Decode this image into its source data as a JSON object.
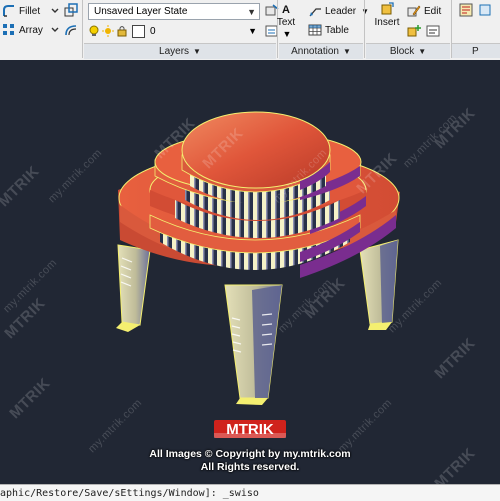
{
  "ribbon": {
    "modify": {
      "fillet": "Fillet",
      "array": "Array"
    },
    "layers": {
      "state": "Unsaved Layer State",
      "current_value": "0",
      "panel_label": "Layers"
    },
    "annotation": {
      "text": "Text",
      "leader": "Leader",
      "table": "Table",
      "panel_label": "Annotation"
    },
    "block": {
      "insert": "Insert",
      "edit": "Edit",
      "panel_label": "Block"
    },
    "extra_panel_label": "P"
  },
  "watermark": {
    "logo_text": "MTRIK",
    "line1": "All Images © Copyright by my.mtrik.com",
    "line2": "All Rights reserved.",
    "brand": "MTRIK",
    "site": "my.mtrik.com"
  },
  "command_line": {
    "text": "aphic/Restore/Save/sEttings/Window]: _swiso"
  },
  "colors": {
    "viewport_bg": "#212734",
    "roof": "#e8603f",
    "roof_band": "#7a2d8f",
    "pillar": "#d9d4a8",
    "pillar_shadow": "#6a6f9a"
  }
}
